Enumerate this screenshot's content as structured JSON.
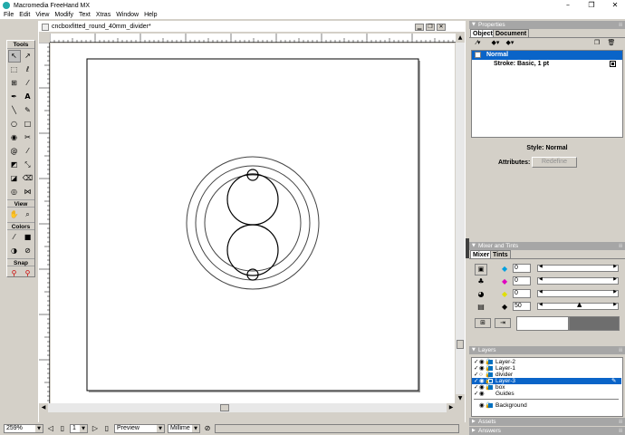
{
  "app": {
    "title": "Macromedia FreeHand MX"
  },
  "menu": [
    "File",
    "Edit",
    "View",
    "Modify",
    "Text",
    "Xtras",
    "Window",
    "Help"
  ],
  "toolbox": {
    "sections": {
      "tools": "Tools",
      "view": "View",
      "colors": "Colors",
      "snap": "Snap"
    }
  },
  "document": {
    "title": "cncboxfitted_round_40mm_divider*",
    "page_number": "1"
  },
  "statusbar": {
    "zoom": "259%",
    "render_mode": "Preview",
    "units": "Millime"
  },
  "properties": {
    "panel_title": "Properties",
    "tabs": [
      "Object",
      "Document"
    ],
    "items": [
      {
        "label": "Normal",
        "selected": true
      },
      {
        "label": "Stroke: Basic, 1 pt",
        "selected": false
      }
    ],
    "style_label": "Style:",
    "style_value": "Normal",
    "attributes_label": "Attributes:",
    "redefine_label": "Redefine"
  },
  "mixer": {
    "panel_title": "Mixer and Tints",
    "tabs": [
      "Mixer",
      "Tints"
    ],
    "values": [
      "0",
      "0",
      "0",
      "50"
    ],
    "swatch_colors": [
      "#00a0e0",
      "#e000c0",
      "#e0e000",
      "#000000"
    ],
    "mixed_color": "#6e6e6e"
  },
  "layers": {
    "panel_title": "Layers",
    "rows": [
      {
        "name": "Layer-2",
        "color": "#0070c0",
        "selected": false
      },
      {
        "name": "Layer-1",
        "color": "#0070c0",
        "selected": false
      },
      {
        "name": "divider",
        "color": "#0070c0",
        "selected": false
      },
      {
        "name": "Layer-3",
        "color": "#0070c0",
        "selected": true
      },
      {
        "name": "box",
        "color": "#0070c0",
        "selected": false
      },
      {
        "name": "Guides",
        "color": "",
        "selected": false
      },
      {
        "name": "Background",
        "color": "#0070c0",
        "selected": false
      }
    ]
  },
  "assets": {
    "panel_title": "Assets"
  },
  "answers": {
    "panel_title": "Answers"
  }
}
